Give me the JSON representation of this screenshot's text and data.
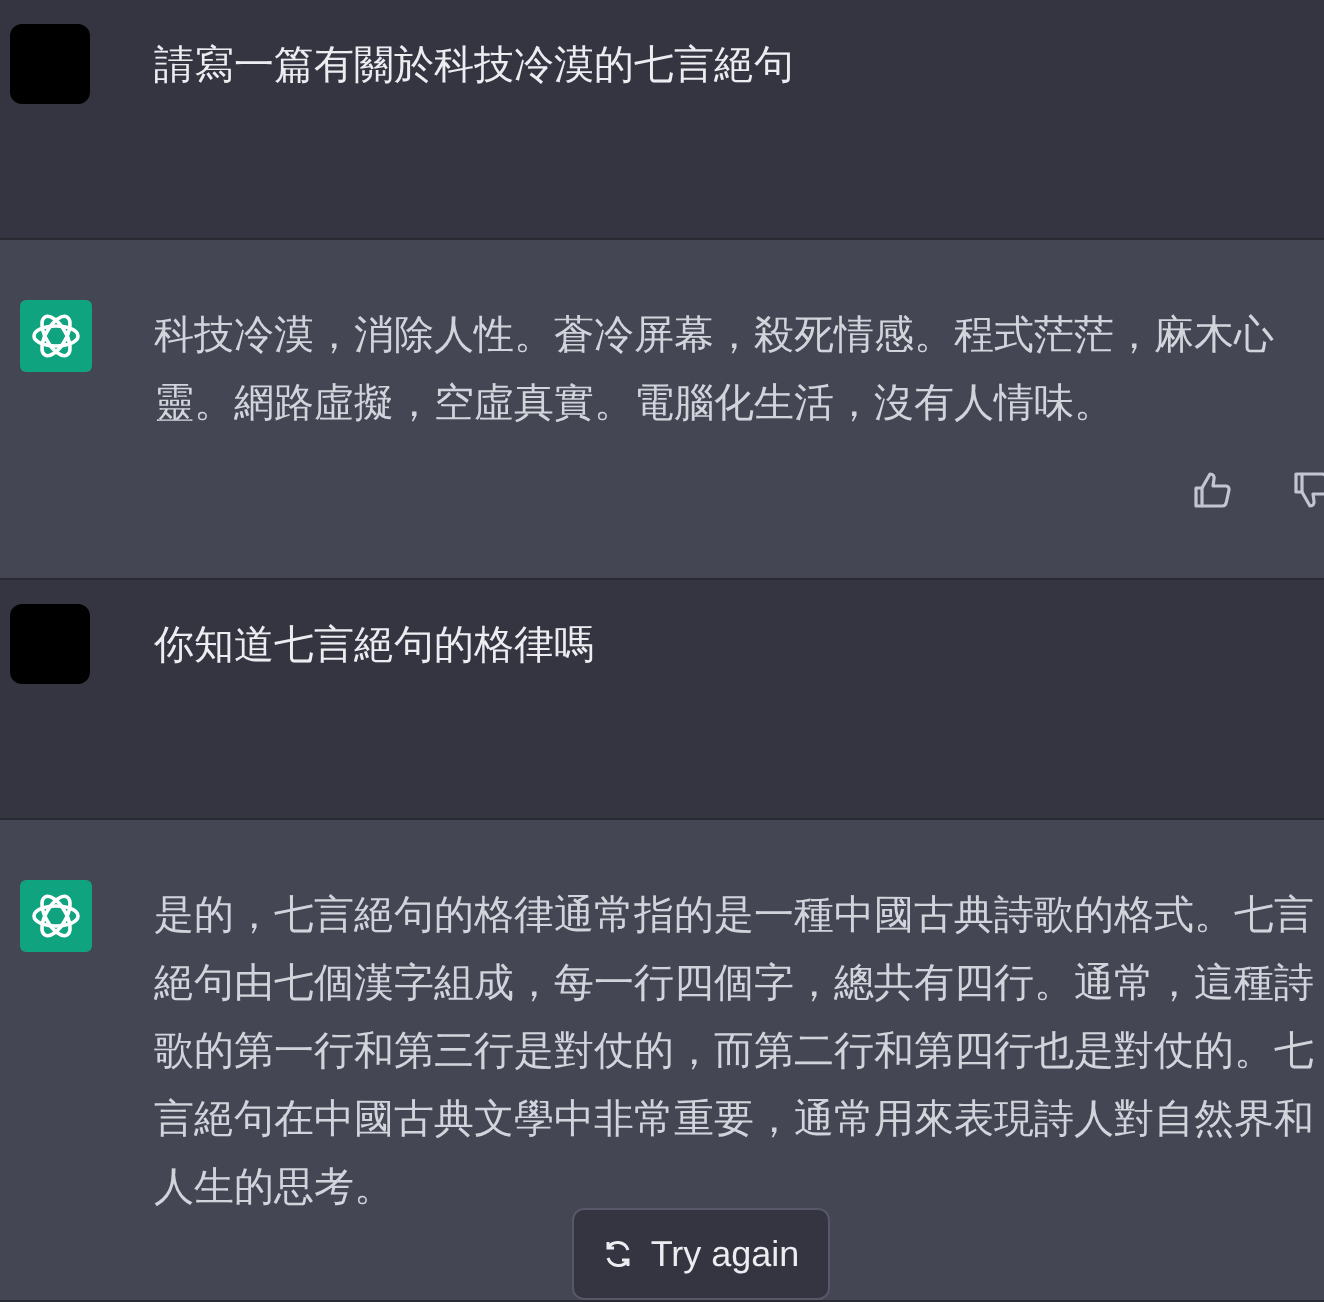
{
  "messages": [
    {
      "kind": "user",
      "text": "請寫一篇有關於科技冷漠的七言絕句",
      "feedback": false
    },
    {
      "kind": "assistant",
      "text": "科技冷漠，消除人性。蒼冷屏幕，殺死情感。程式茫茫，麻木心靈。網路虛擬，空虛真實。電腦化生活，沒有人情味。",
      "feedback": true
    },
    {
      "kind": "user",
      "text": "你知道七言絕句的格律嗎",
      "feedback": false
    },
    {
      "kind": "assistant",
      "text": "是的，七言絕句的格律通常指的是一種中國古典詩歌的格式。七言絕句由七個漢字組成，每一行四個字，總共有四行。通常，這種詩歌的第一行和第三行是對仗的，而第二行和第四行也是對仗的。七言絕句在中國古典文學中非常重要，通常用來表現詩人對自然界和人生的思考。",
      "feedback": false
    }
  ],
  "try_again": {
    "label": "Try again"
  }
}
